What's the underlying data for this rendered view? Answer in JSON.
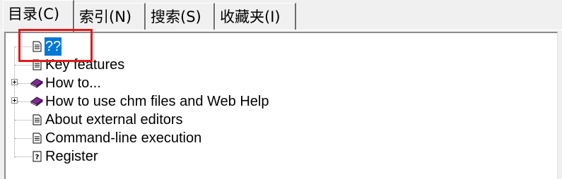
{
  "tabs": [
    {
      "label": "目录(C)",
      "active": true
    },
    {
      "label": "索引(N)",
      "active": false
    },
    {
      "label": "搜索(S)",
      "active": false
    },
    {
      "label": "收藏夹(I)",
      "active": false
    }
  ],
  "tree": {
    "items": [
      {
        "label": "??",
        "icon": "page-icon",
        "expandable": false,
        "selected": true
      },
      {
        "label": "Key features",
        "icon": "page-icon",
        "expandable": false,
        "selected": false
      },
      {
        "label": "How to...",
        "icon": "book-icon",
        "expandable": true,
        "selected": false
      },
      {
        "label": "How to use chm files and Web Help",
        "icon": "book-icon",
        "expandable": true,
        "selected": false
      },
      {
        "label": "About external editors",
        "icon": "page-icon",
        "expandable": false,
        "selected": false
      },
      {
        "label": "Command-line execution",
        "icon": "page-icon",
        "expandable": false,
        "selected": false
      },
      {
        "label": "Register",
        "icon": "help-page-icon",
        "expandable": false,
        "selected": false
      }
    ]
  },
  "colors": {
    "selection": "#0078d7",
    "highlight_box": "#e21a1a",
    "book": "#7b2d8e"
  }
}
